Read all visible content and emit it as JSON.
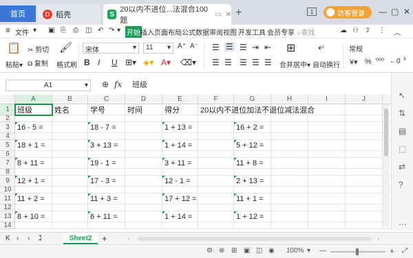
{
  "titlebar": {
    "home_tab": "首页",
    "docer_tab": "稻壳",
    "doc_tab": "20以内不进位...法混合100题",
    "doc_badge": "S",
    "docer_badge": "D",
    "add_tab": "+",
    "login_label": "访客登录",
    "minimize": "—",
    "maximize": "▢",
    "close": "✕"
  },
  "menubar": {
    "hamburger": "≡",
    "file": "文件",
    "items": [
      "开始",
      "插入",
      "页面布局",
      "公式",
      "数据",
      "审阅",
      "视图",
      "开发工具",
      "会员专享"
    ],
    "search_placeholder": "查找"
  },
  "ribbon": {
    "paste": "粘贴",
    "cut": "剪切",
    "copy": "复制",
    "format_painter": "格式刷",
    "font_name": "宋体",
    "font_size": "11",
    "bold": "B",
    "italic": "I",
    "underline": "U",
    "merge_center": "合并居中",
    "auto_wrap": "自动换行",
    "number_format": "常规",
    "currency": "¥",
    "percent": "%"
  },
  "formula_bar": {
    "cell_ref": "A1",
    "fx_label": "fx",
    "content": "班级"
  },
  "grid": {
    "columns": [
      "A",
      "B",
      "C",
      "D",
      "E",
      "F",
      "G",
      "H",
      "I",
      "J"
    ],
    "rows": [
      "1",
      "2",
      "3",
      "4",
      "5",
      "6",
      "7",
      "8",
      "9",
      "10",
      "11",
      "12",
      "13",
      "14"
    ],
    "header_row": {
      "a": "班级",
      "b": "姓名",
      "c": "学号",
      "d": "时间",
      "e": "得分",
      "f": "20以内不进位加法不退位减法混合"
    },
    "problems": [
      {
        "a": "16 - 5 =",
        "c": "18 - 7 =",
        "e": "1 + 13 =",
        "g": "16 + 2 ="
      },
      {
        "a": "18 + 1 =",
        "c": "3 + 13 =",
        "e": "1 + 14 =",
        "g": "5 + 12 ="
      },
      {
        "a": "8 + 11 =",
        "c": "19 - 1 =",
        "e": "3 + 11 =",
        "g": "11 + 8 ="
      },
      {
        "a": "12 + 1 =",
        "c": "17 - 3 =",
        "e": "12 - 1 =",
        "g": "2 + 13 ="
      },
      {
        "a": "11 + 2 =",
        "c": "11 + 3 =",
        "e": "17 + 12 =",
        "g": "11 + 1 ="
      },
      {
        "a": "8 + 10 =",
        "c": "6 + 11 =",
        "e": "1 + 14 =",
        "g": "1 + 12 ="
      }
    ]
  },
  "sheets": {
    "active": "Sheet2",
    "add": "+"
  },
  "status": {
    "zoom": "100%",
    "zoom_minus": "—",
    "zoom_plus": "+"
  },
  "colors": {
    "accent_green": "#1c9b56",
    "home_blue": "#3a77d6",
    "login_orange": "#f0a23a"
  }
}
